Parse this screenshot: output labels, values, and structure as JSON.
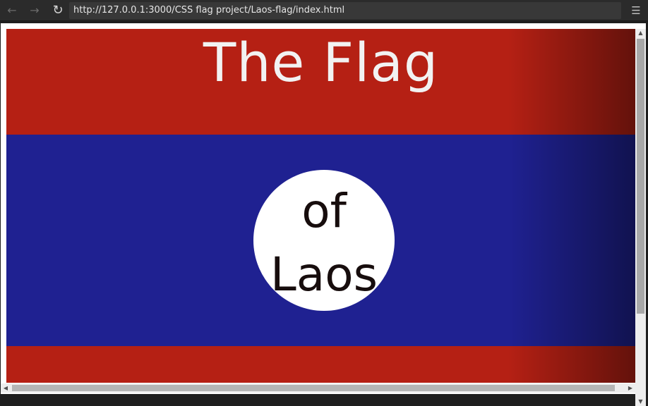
{
  "browser": {
    "url": "http://127.0.0.1:3000/CSS flag project/Laos-flag/index.html",
    "back_icon": "arrow-left-icon",
    "forward_icon": "arrow-right-icon",
    "reload_icon": "reload-icon",
    "menu_icon": "hamburger-menu-icon"
  },
  "page": {
    "title": "The Flag",
    "circle_line1": "of",
    "circle_line2": "Laos"
  },
  "colors": {
    "red": "#b52014",
    "blue": "#1f2191",
    "circle": "#ffffff",
    "title_text": "#f2f2f2",
    "circle_text": "#170d0d"
  }
}
